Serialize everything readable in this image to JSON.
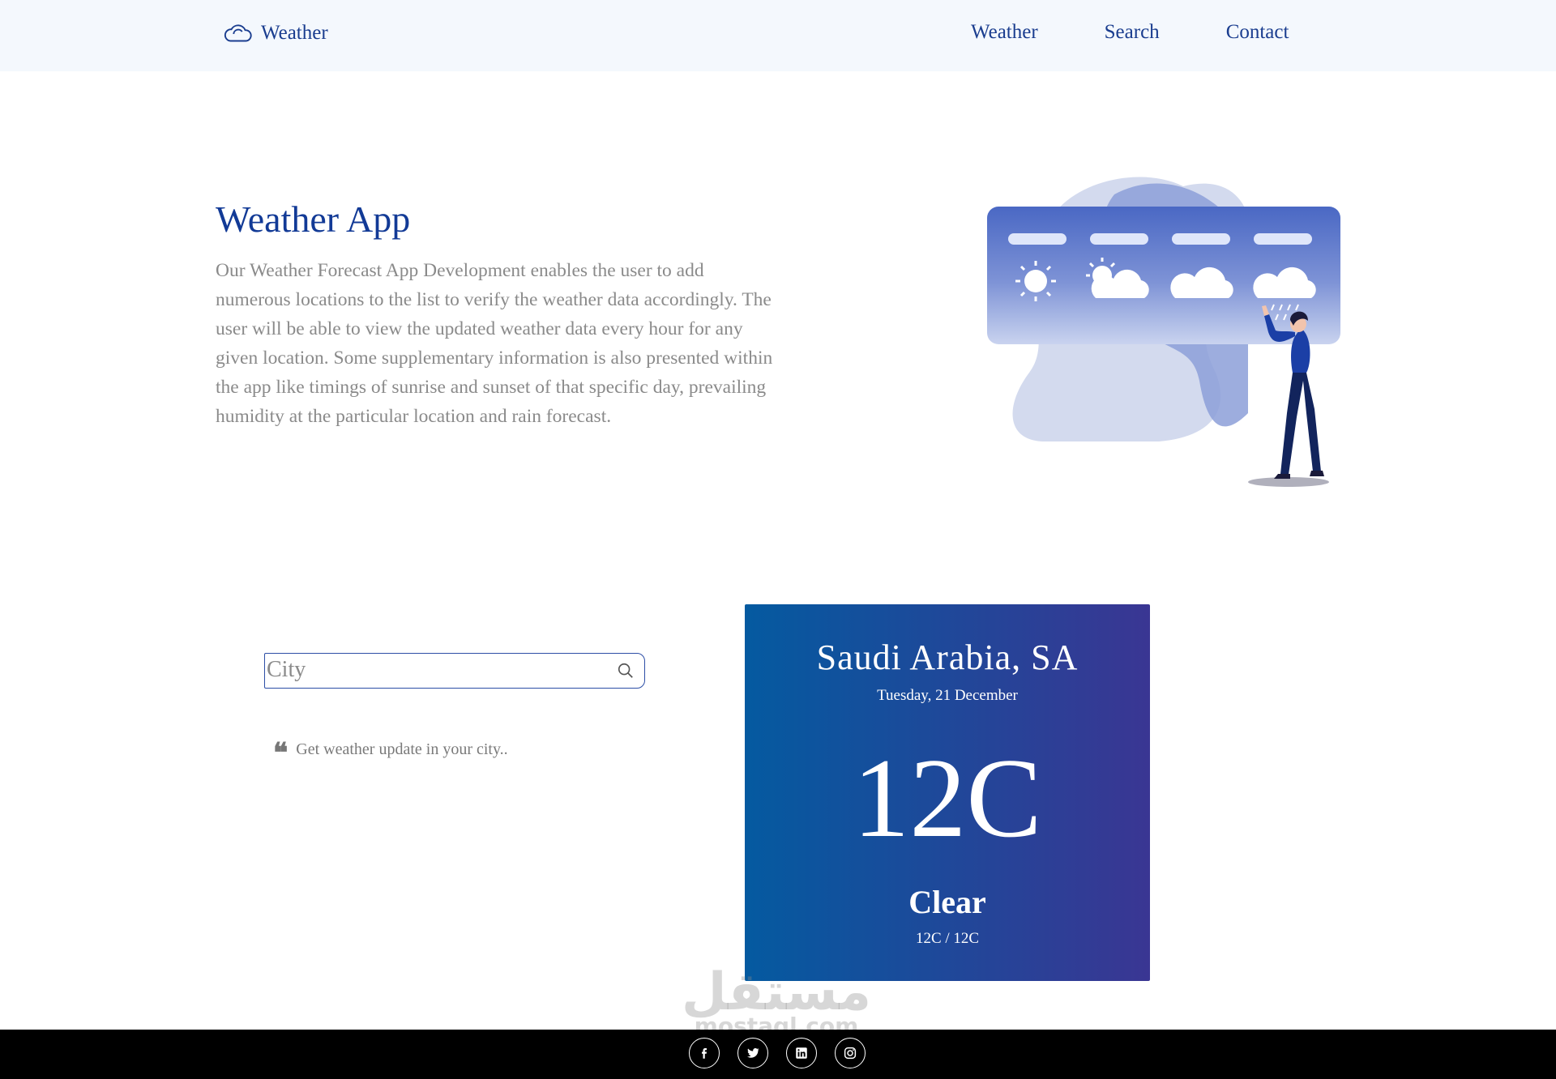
{
  "brand": {
    "name": "Weather",
    "icon": "cloud-icon"
  },
  "nav": {
    "links": [
      "Weather",
      "Search",
      "Contact"
    ]
  },
  "hero": {
    "title": "Weather App",
    "description": "Our Weather Forecast App Development enables the user to add numerous locations to the list to verify the weather data accordingly. The user will be able to view the updated weather data every hour for any given location. Some supplementary information is also presented within the app like timings of sunrise and sunset of that specific day, prevailing humidity at the particular location and rain forecast."
  },
  "search": {
    "placeholder": "City",
    "value": "",
    "icon": "search-icon"
  },
  "tagline": {
    "icon": "quote-icon",
    "text": "Get weather update in your city.."
  },
  "weather": {
    "location": "Saudi Arabia, SA",
    "date": "Tuesday, 21 December",
    "temp": "12C",
    "condition": "Clear",
    "range": "12C / 12C"
  },
  "watermark": {
    "arabic": "مستقل",
    "latin": "mostaql.com"
  },
  "footer": {
    "social": [
      "facebook-icon",
      "twitter-icon",
      "linkedin-icon",
      "instagram-icon"
    ]
  },
  "colors": {
    "navbar_bg": "#f4f8fd",
    "brand": "#1a3d8f",
    "title": "#123a96",
    "card_gradient_start": "#045aa0",
    "card_gradient_end": "#3a3693",
    "footer_bg": "#000000"
  }
}
